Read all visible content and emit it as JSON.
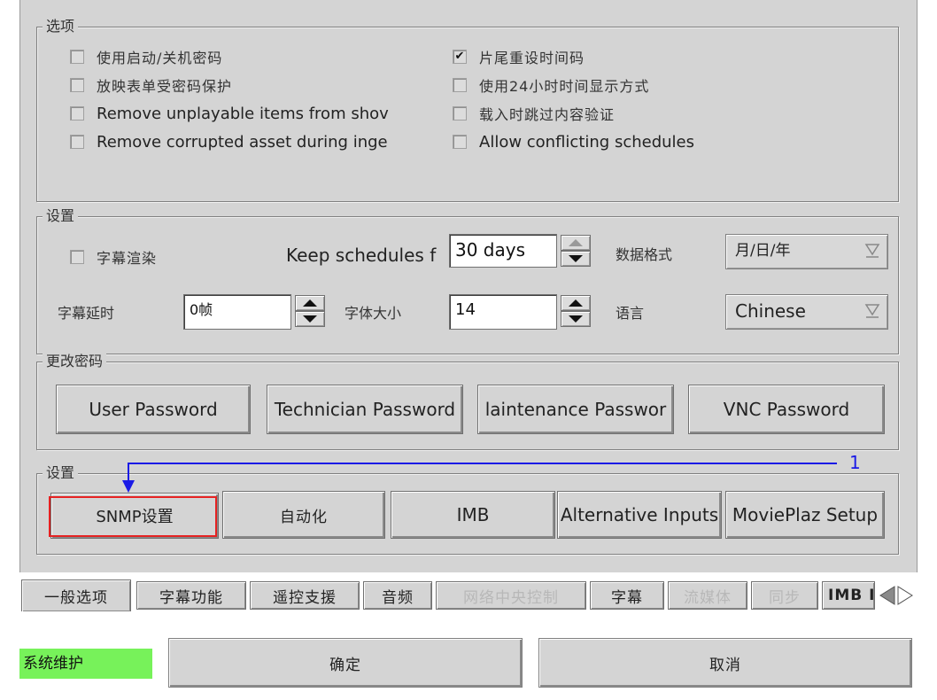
{
  "options": {
    "title": "选项",
    "left": [
      {
        "label": "使用启动/关机密码",
        "checked": false,
        "zh": true
      },
      {
        "label": "放映表单受密码保护",
        "checked": false,
        "zh": true
      },
      {
        "label": "Remove unplayable items from shov",
        "checked": false,
        "zh": false
      },
      {
        "label": "Remove corrupted asset during inge",
        "checked": false,
        "zh": false
      }
    ],
    "right": [
      {
        "label": "片尾重设时间码",
        "checked": true,
        "zh": true,
        "mark": "✔"
      },
      {
        "label": "使用24小时时间显示方式",
        "checked": false,
        "zh": true
      },
      {
        "label": "载入时跳过内容验证",
        "checked": false,
        "zh": true
      },
      {
        "label": "Allow conflicting schedules",
        "checked": false,
        "zh": false
      }
    ]
  },
  "settings1": {
    "title": "设置",
    "subtitle_render_label": "字幕渲染",
    "keep_schedules_label": "Keep schedules f",
    "keep_schedules_value": "30  days",
    "date_format_label": "数据格式",
    "date_format_value": "月/日/年",
    "subtitle_delay_label": "字幕延时",
    "subtitle_delay_value": "0帧",
    "font_size_label": "字体大小",
    "font_size_value": "14",
    "language_label": "语言",
    "language_value": "Chinese"
  },
  "password": {
    "title": "更改密码",
    "buttons": [
      "User Password",
      "Technician Password",
      "laintenance Passwor",
      "VNC Password"
    ]
  },
  "settings2": {
    "title": "设置",
    "buttons": [
      "SNMP设置",
      "自动化",
      "IMB",
      "Alternative Inputs",
      "MoviePlaz Setup"
    ],
    "annotation_number": "1",
    "annotation_color": "#1a1ae6",
    "highlight_color": "#e52222"
  },
  "tabs": [
    {
      "label": "一般选项",
      "active": true,
      "disabled": false
    },
    {
      "label": "字幕功能",
      "active": false,
      "disabled": false
    },
    {
      "label": "遥控支援",
      "active": false,
      "disabled": false
    },
    {
      "label": "音频",
      "active": false,
      "disabled": false
    },
    {
      "label": "网络中央控制",
      "active": false,
      "disabled": true
    },
    {
      "label": "字幕",
      "active": false,
      "disabled": false
    },
    {
      "label": "流媒体",
      "active": false,
      "disabled": true
    },
    {
      "label": "同步",
      "active": false,
      "disabled": true
    },
    {
      "label": "IMB I",
      "active": false,
      "disabled": false
    }
  ],
  "footer": {
    "status_text": "系统维护",
    "status_color": "#77f25a",
    "ok_label": "确定",
    "cancel_label": "取消"
  }
}
